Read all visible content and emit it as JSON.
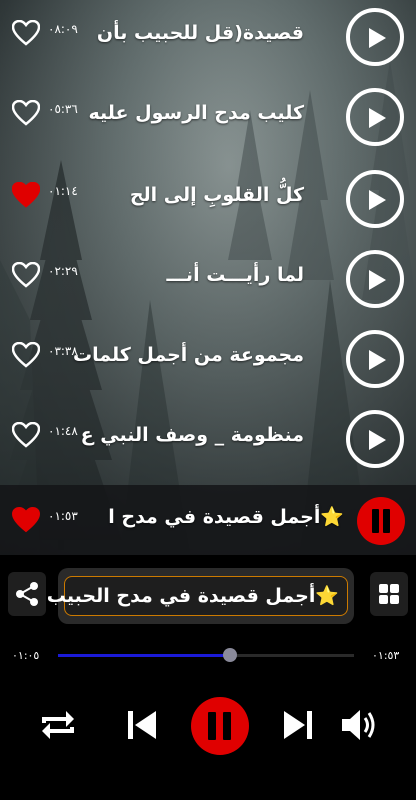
{
  "tracks": [
    {
      "title": "قصيدة(قل للحبيب بأن",
      "time": "٠٨:٠٩",
      "liked": false
    },
    {
      "title": "كليب مدح الرسول عليه",
      "time": "٠٥:٣٦",
      "liked": false
    },
    {
      "title": "كلُّ القلوبِ إلى الح",
      "time": "٠١:١٤",
      "liked": true
    },
    {
      "title": "لما رأيـــت أنـــ",
      "time": "٠٢:٢٩",
      "liked": false
    },
    {
      "title": "مجموعة من أجمل كلمات",
      "time": "٠٣:٣٨",
      "liked": false
    },
    {
      "title": "منظومة _ وصف النبي ع",
      "time": "٠١:٤٨",
      "liked": false
    }
  ],
  "active_track": {
    "title": "⭐أجمل قصيدة في مدح ا",
    "time": "٠١:٥٣",
    "liked": true
  },
  "player": {
    "now_playing_title": "⭐أجمل قصيدة في مدح الحبيب",
    "elapsed": "٠١:٠٥",
    "duration": "٠١:٥٣",
    "progress": 0.58
  },
  "icons": {
    "share": "share-icon",
    "grid": "grid-icon",
    "repeat": "repeat-icon",
    "previous": "skip-previous-icon",
    "pause": "pause-icon",
    "next": "skip-next-icon",
    "volume": "volume-icon",
    "heart": "heart-icon",
    "play": "play-icon"
  },
  "colors": {
    "accent_red": "#e00000",
    "progress_blue": "#1a1ad8",
    "title_border": "#cc7a00"
  }
}
